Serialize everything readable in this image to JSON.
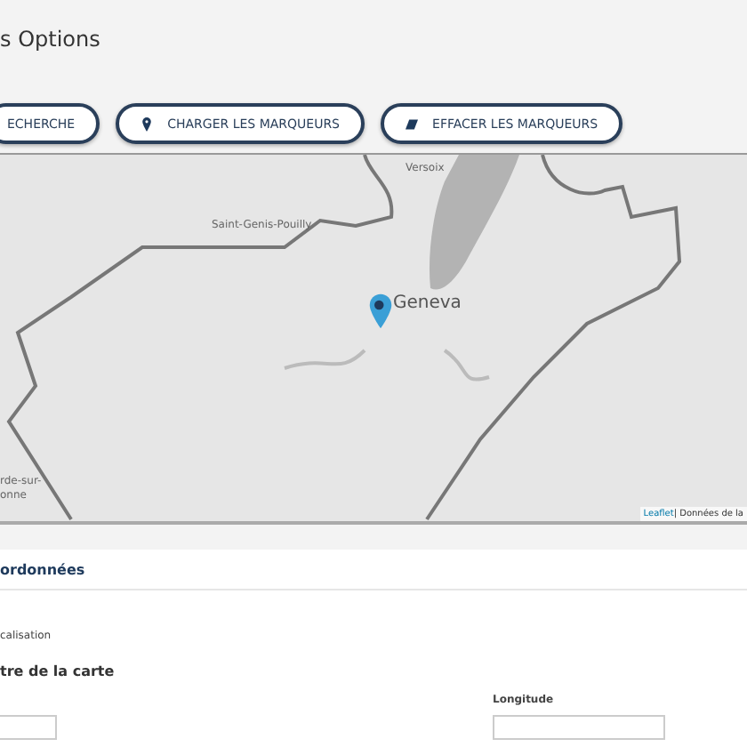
{
  "page": {
    "title": "s Options"
  },
  "buttons": [
    {
      "label": "ECHERCHE",
      "kind": "plain"
    },
    {
      "label": "CHARGER LES MARQUEURS",
      "kind": "pin"
    },
    {
      "label": "EFFACER LES MARQUEURS",
      "kind": "eraser"
    }
  ],
  "map": {
    "labels": [
      {
        "text": "Versoix",
        "kind": "town"
      },
      {
        "text": "Saint-Genis-Pouilly",
        "kind": "town"
      },
      {
        "text": "Geneva",
        "kind": "city"
      },
      {
        "text": "rde-sur-",
        "kind": "town"
      },
      {
        "text": "onne",
        "kind": "town"
      }
    ],
    "attribution_link": "Leaflet",
    "attribution_text": "| Données de la"
  },
  "panel": {
    "title": "ordonnées",
    "subtitle": "calisation",
    "section": "tre de la carte",
    "fields": [
      {
        "kind": "input"
      },
      {
        "kind": "input",
        "label": "Longitude"
      }
    ]
  }
}
